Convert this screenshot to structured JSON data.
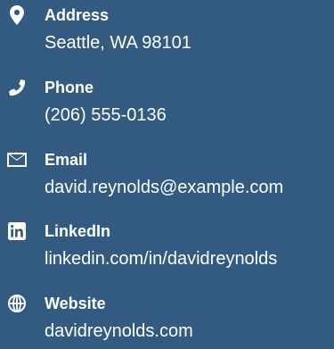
{
  "contacts": {
    "address": {
      "icon": "map-marker-icon",
      "label": "Address",
      "value": "Seattle, WA 98101"
    },
    "phone": {
      "icon": "phone-icon",
      "label": "Phone",
      "value": "(206) 555-0136"
    },
    "email": {
      "icon": "envelope-icon",
      "label": "Email",
      "value": "david.reynolds@example.com"
    },
    "linkedin": {
      "icon": "linkedin-icon",
      "label": "LinkedIn",
      "value": "linkedin.com/in/davidreynolds"
    },
    "website": {
      "icon": "globe-icon",
      "label": "Website",
      "value": "davidreynolds.com"
    }
  },
  "colors": {
    "background": "#335a80",
    "text": "#ffffff"
  }
}
